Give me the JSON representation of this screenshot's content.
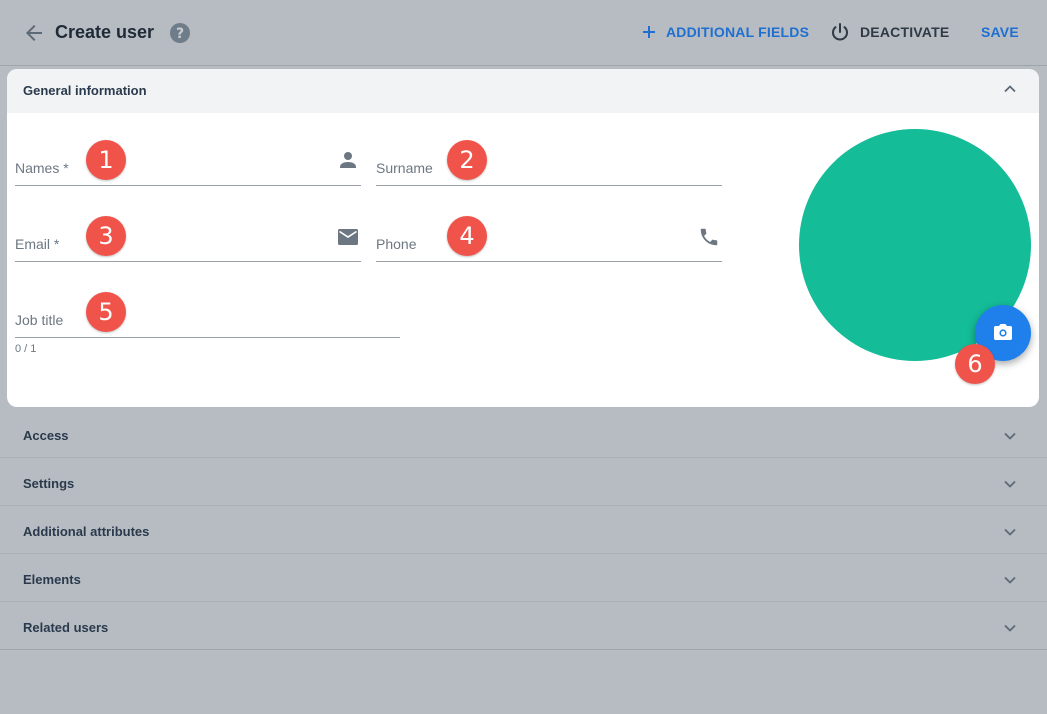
{
  "header": {
    "title": "Create user",
    "actions": {
      "additional_fields": "ADDITIONAL FIELDS",
      "deactivate": "DEACTIVATE",
      "save": "SAVE"
    }
  },
  "general_section": {
    "title": "General information",
    "fields": {
      "names": {
        "label": "Names *",
        "value": ""
      },
      "surname": {
        "label": "Surname",
        "value": ""
      },
      "email": {
        "label": "Email *",
        "value": ""
      },
      "phone": {
        "label": "Phone",
        "value": ""
      },
      "job_title": {
        "label": "Job title",
        "value": "",
        "counter": "0 / 1"
      }
    },
    "avatar_color": "#14bc97"
  },
  "markers": [
    "1",
    "2",
    "3",
    "4",
    "5",
    "6"
  ],
  "sections": [
    {
      "label": "Access"
    },
    {
      "label": "Settings"
    },
    {
      "label": "Additional attributes"
    },
    {
      "label": "Elements"
    },
    {
      "label": "Related users"
    }
  ],
  "colors": {
    "accent": "#1f80eb",
    "link": "#1f6fd1",
    "marker": "#f0534a",
    "background": "#b6bcc2"
  }
}
